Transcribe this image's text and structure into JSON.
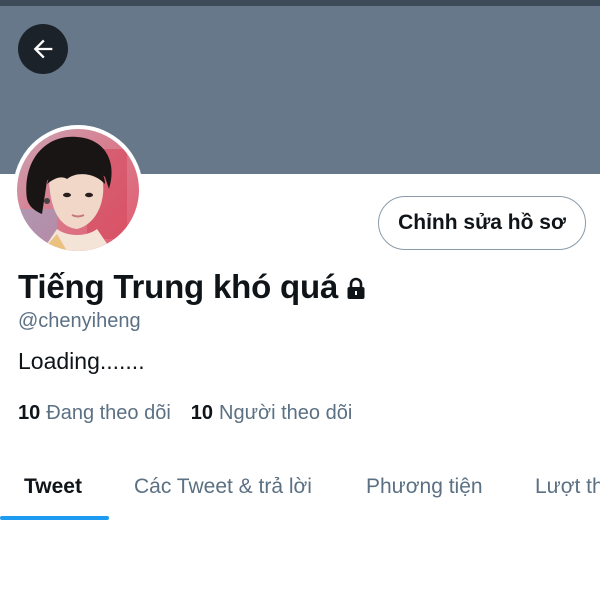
{
  "header": {
    "back_icon": "arrow-left-icon",
    "banner_color": "#66788a"
  },
  "profile": {
    "edit_label": "Chỉnh sửa hồ sơ",
    "display_name": "Tiếng Trung khó quá",
    "lock_icon": "lock-icon",
    "handle": "@chenyiheng",
    "bio": "Loading.......",
    "following_count": "10",
    "following_label": "Đang theo dõi",
    "followers_count": "10",
    "followers_label": "Người theo dõi"
  },
  "tabs": [
    {
      "label": "Tweet",
      "active": true
    },
    {
      "label": "Các Tweet & trả lời",
      "active": false
    },
    {
      "label": "Phương tiện",
      "active": false
    },
    {
      "label": "Lượt thích",
      "active": false
    }
  ],
  "colors": {
    "accent": "#1d9bf0",
    "text_primary": "#0f1419",
    "text_secondary": "#5b7083"
  }
}
